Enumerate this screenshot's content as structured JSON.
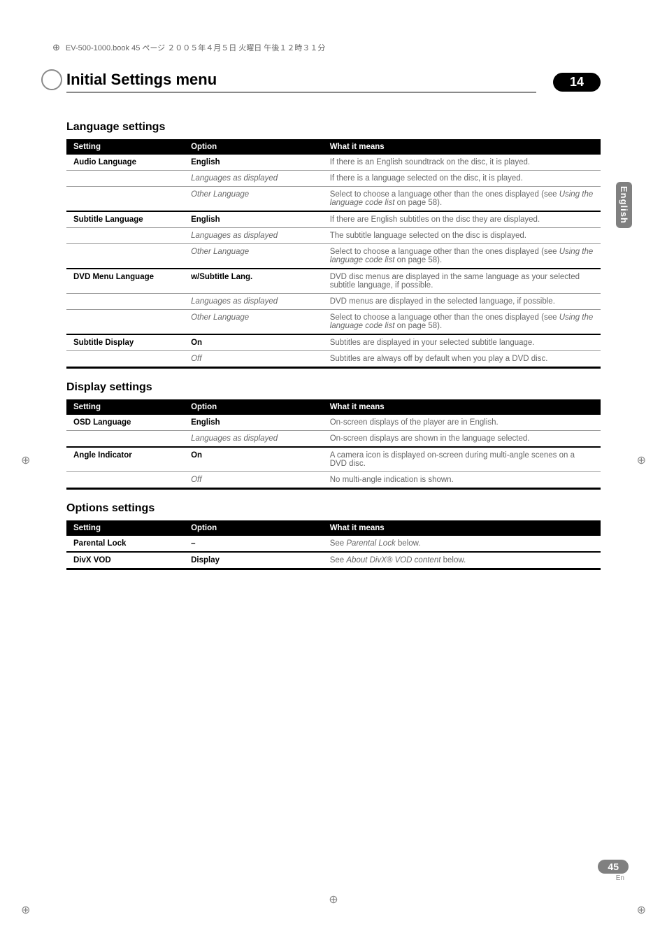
{
  "doc_header": "EV-500-1000.book 45 ページ ２００５年４月５日 火曜日 午後１２時３１分",
  "chapter": {
    "title": "Initial Settings menu",
    "number": "14"
  },
  "side_tab": "English",
  "sections": {
    "language": {
      "heading": "Language settings",
      "cols": [
        "Setting",
        "Option",
        "What it means"
      ],
      "rows": [
        {
          "s": "Audio Language",
          "o": "English",
          "ob": true,
          "m": "If there is an English soundtrack on the disc, it is played."
        },
        {
          "s": "",
          "o": "Languages as displayed",
          "oi": true,
          "m": "If there is a language selected on the disc, it is played."
        },
        {
          "s": "",
          "o": "Other Language",
          "oi": true,
          "m": "Select to choose a language other than the ones displayed (see <i>Using the language code list</i> on page 58).",
          "end": true
        },
        {
          "s": "Subtitle Language",
          "o": "English",
          "ob": true,
          "m": "If there are English subtitles on the disc they are displayed."
        },
        {
          "s": "",
          "o": "Languages as displayed",
          "oi": true,
          "m": "The subtitle language selected on the disc is displayed."
        },
        {
          "s": "",
          "o": "Other Language",
          "oi": true,
          "m": "Select to choose a language other than the ones displayed (see <i>Using the language code list</i> on page 58).",
          "end": true
        },
        {
          "s": "DVD Menu Language",
          "o": "w/Subtitle Lang.",
          "ob": true,
          "m": "DVD disc menus are displayed in the same language as your selected subtitle language, if possible."
        },
        {
          "s": "",
          "o": "Languages as displayed",
          "oi": true,
          "m": "DVD menus are displayed in the selected language, if possible."
        },
        {
          "s": "",
          "o": "Other Language",
          "oi": true,
          "m": "Select to choose a language other than the ones displayed (see <i>Using the language code list</i> on page 58).",
          "end": true
        },
        {
          "s": "Subtitle Display",
          "o": "On",
          "ob": true,
          "m": "Subtitles are displayed in your selected subtitle language."
        },
        {
          "s": "",
          "o": "Off",
          "oi": true,
          "m": "Subtitles are always off by default when you play a DVD disc."
        }
      ]
    },
    "display": {
      "heading": "Display settings",
      "cols": [
        "Setting",
        "Option",
        "What it means"
      ],
      "rows": [
        {
          "s": "OSD Language",
          "o": "English",
          "ob": true,
          "m": "On-screen displays of the player are in English."
        },
        {
          "s": "",
          "o": "Languages as displayed",
          "oi": true,
          "m": "On-screen displays are shown in the language selected.",
          "end": true
        },
        {
          "s": "Angle Indicator",
          "o": "On",
          "ob": true,
          "m": "A camera icon is displayed on-screen during multi-angle scenes on a DVD disc."
        },
        {
          "s": "",
          "o": "Off",
          "oi": true,
          "m": "No multi-angle indication is shown."
        }
      ]
    },
    "options": {
      "heading": "Options settings",
      "cols": [
        "Setting",
        "Option",
        "What it means"
      ],
      "rows": [
        {
          "s": "Parental Lock",
          "o": "–",
          "ob": true,
          "m": "See <i>Parental Lock</i> below.",
          "end": true
        },
        {
          "s": "DivX VOD",
          "o": "Display",
          "ob": true,
          "m": "See <i>About DivX® VOD content</i> below."
        }
      ]
    }
  },
  "footer": {
    "page": "45",
    "lang": "En"
  }
}
